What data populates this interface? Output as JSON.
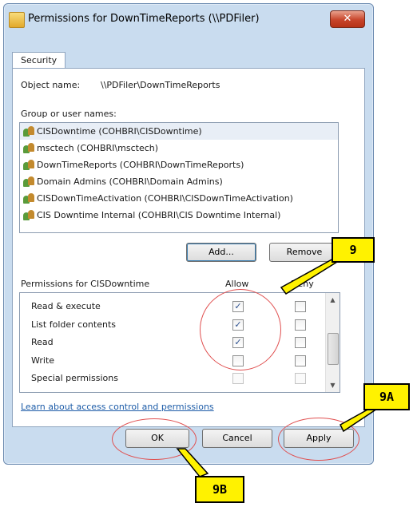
{
  "window": {
    "title": "Permissions for DownTimeReports (\\\\PDFiler)",
    "close_label": "✕"
  },
  "tabs": [
    {
      "label": "Security"
    }
  ],
  "object_name": {
    "label": "Object name:",
    "value": "\\\\PDFiler\\DownTimeReports"
  },
  "groups": {
    "label": "Group or user names:",
    "items": [
      {
        "label": "CISDowntime (COHBRI\\CISDowntime)"
      },
      {
        "label": "msctech (COHBRI\\msctech)"
      },
      {
        "label": "DownTimeReports (COHBRI\\DownTimeReports)"
      },
      {
        "label": "Domain Admins (COHBRI\\Domain Admins)"
      },
      {
        "label": "CISDownTimeActivation (COHBRI\\CISDownTimeActivation)"
      },
      {
        "label": "CIS Downtime Internal (COHBRI\\CIS Downtime Internal)"
      }
    ],
    "selected_index": 0
  },
  "buttons": {
    "add": "Add...",
    "remove": "Remove",
    "ok": "OK",
    "cancel": "Cancel",
    "apply": "Apply"
  },
  "permissions": {
    "label": "Permissions for CISDowntime",
    "allow_header": "Allow",
    "deny_header": "Deny",
    "rows": [
      {
        "name": "Read & execute",
        "allow": true,
        "deny": false,
        "enabled": true
      },
      {
        "name": "List folder contents",
        "allow": true,
        "deny": false,
        "enabled": true
      },
      {
        "name": "Read",
        "allow": true,
        "deny": false,
        "enabled": true
      },
      {
        "name": "Write",
        "allow": false,
        "deny": false,
        "enabled": true
      },
      {
        "name": "Special permissions",
        "allow": false,
        "deny": false,
        "enabled": false
      }
    ]
  },
  "help_link": "Learn about access control and permissions",
  "callouts": {
    "c9": "9",
    "c9a": "9A",
    "c9b": "9B"
  },
  "colors": {
    "titlebar": "#c9dcef",
    "close": "#c7442a",
    "callout_fill": "#fff200",
    "ellipse": "#e05050",
    "link": "#1d5ca8"
  }
}
